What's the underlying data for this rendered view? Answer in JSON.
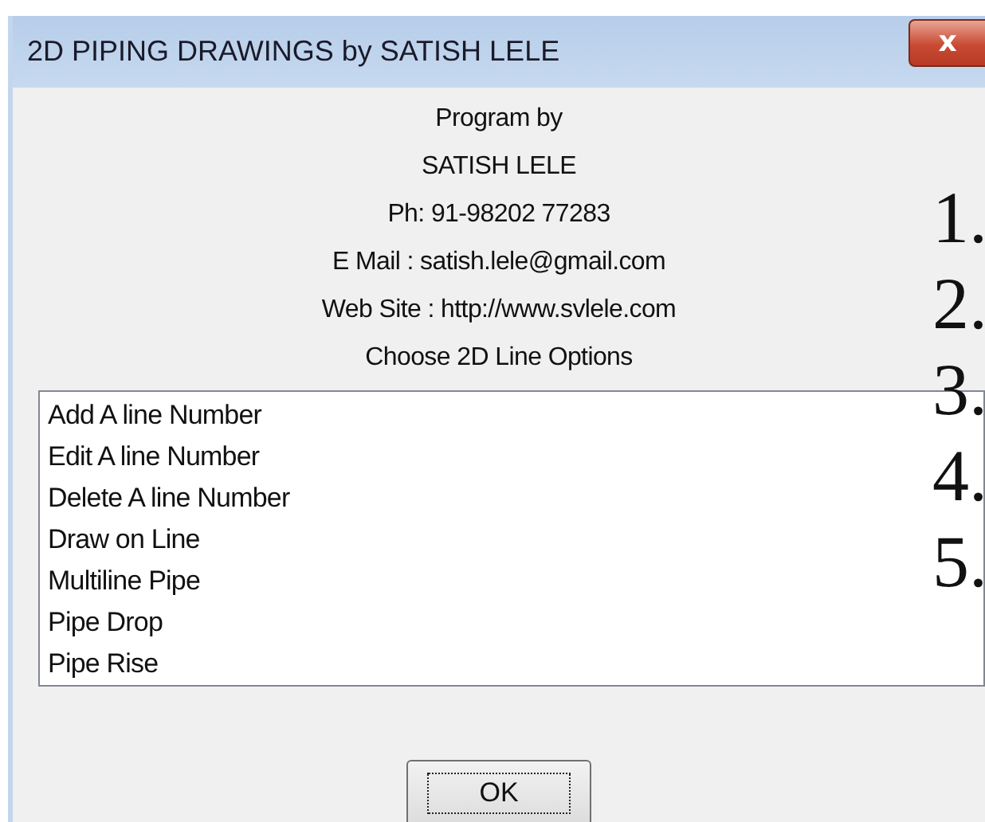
{
  "window": {
    "title": "2D PIPING DRAWINGS by SATISH LELE",
    "close_label": "x"
  },
  "info_lines": [
    "Program by",
    "SATISH LELE",
    "Ph: 91-98202 77283",
    "E Mail : satish.lele@gmail.com",
    "Web Site : http://www.svlele.com",
    "Choose 2D Line Options"
  ],
  "options": [
    {
      "label": "Add A line Number",
      "selected": false
    },
    {
      "label": "Edit A line Number",
      "selected": false
    },
    {
      "label": "Delete A line Number",
      "selected": false
    },
    {
      "label": "Draw on Line",
      "selected": false
    },
    {
      "label": "Multiline Pipe",
      "selected": false
    },
    {
      "label": "Pipe Drop",
      "selected": false
    },
    {
      "label": "Pipe Rise",
      "selected": false
    }
  ],
  "ok_button": "OK",
  "overlay_numbers": [
    "1.",
    "2.",
    "3.",
    "4.",
    "5."
  ]
}
